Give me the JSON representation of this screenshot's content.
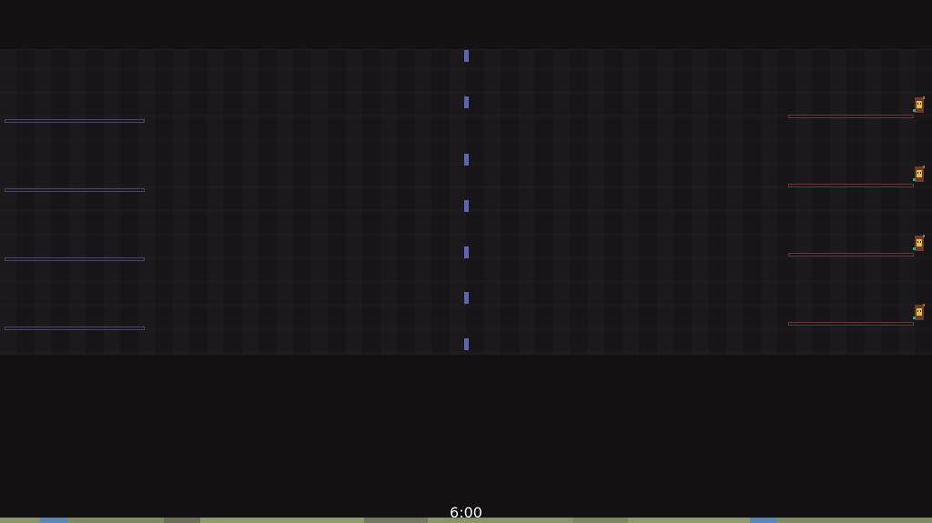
{
  "hud": {
    "timer": "6:00"
  },
  "colors": {
    "background": "#131112",
    "arena": "#171517",
    "center_line": "#5a66b4",
    "left_team": "#4a4566",
    "right_team": "#5c3a36",
    "timer_text": "#ffffff"
  },
  "lanes": {
    "count": 4
  },
  "icons": {
    "unit": "gold-tower-unit-icon"
  }
}
